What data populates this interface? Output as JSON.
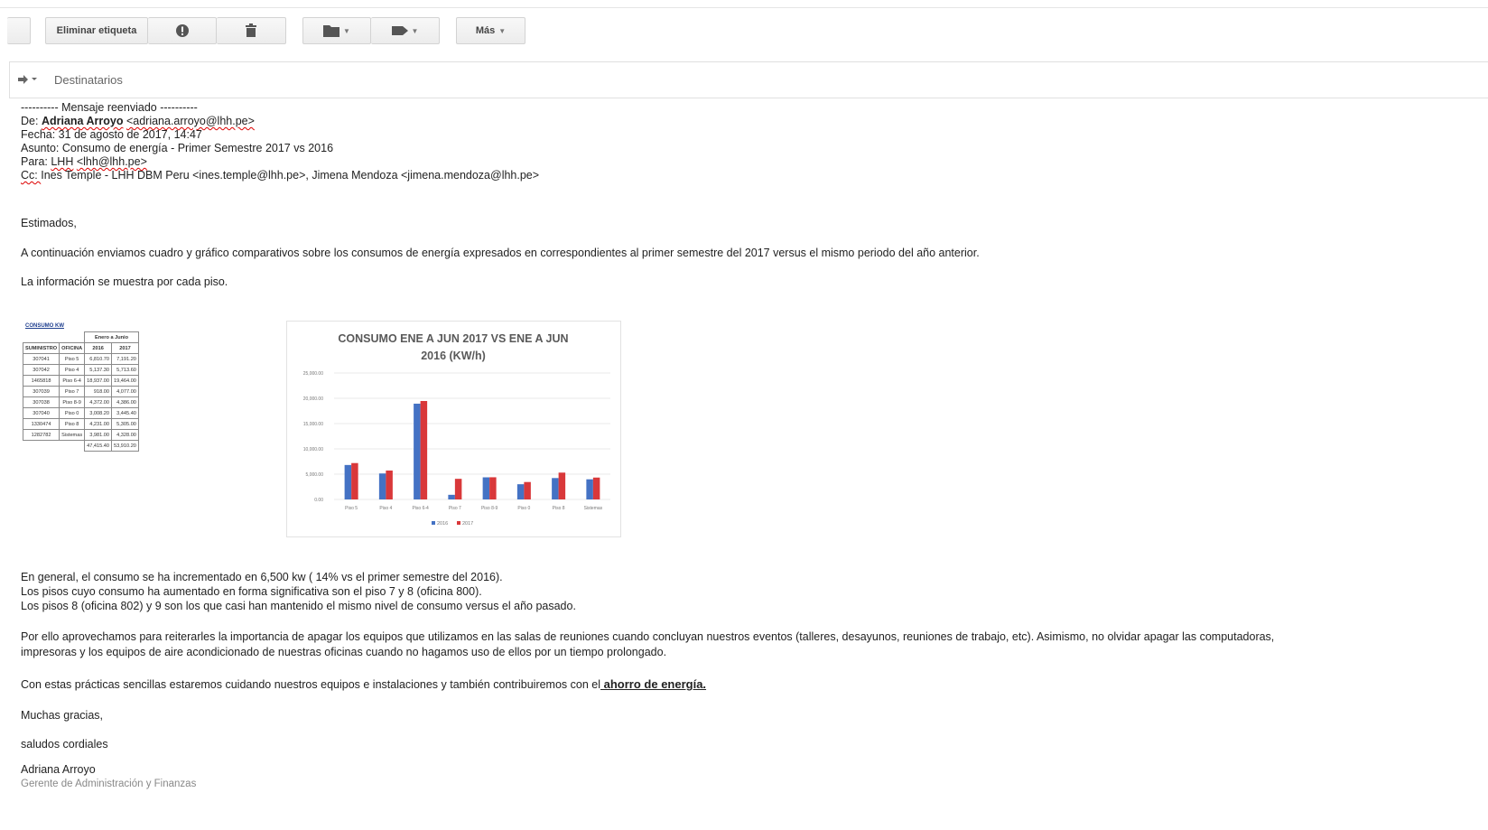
{
  "toolbar": {
    "remove_label": "Eliminar etiqueta",
    "more_label": "Más"
  },
  "recipients_label": "Destinatarios",
  "forward": {
    "header": "---------- Mensaje reenviado ----------",
    "from_label": "De: ",
    "from_name": "Adriana Arroyo",
    "from_email": "<adriana.arroyo@lhh.pe>",
    "date_line": "Fecha: 31 de agosto de 2017, 14:47",
    "subject_line": "Asunto: Consumo de energía - Primer Semestre 2017 vs 2016",
    "to_label": "Para: ",
    "to_name": "LHH",
    "to_email": "<lhh@lhh.pe>",
    "cc_label": "Cc: ",
    "cc_text": "Ines Temple - LHH DBM Peru <ines.temple@lhh.pe>, Jimena Mendoza <jimena.mendoza@lhh.pe>"
  },
  "body": {
    "greeting": "Estimados,",
    "intro": "A continuación enviamos  cuadro y gráfico comparativos sobre los consumos de energía expresados en  correspondientes al primer semestre del 2017 versus el mismo periodo del año anterior.",
    "info": "La información se muestra por cada piso.",
    "summary_1": "En general, el consumo se ha incrementado en 6,500 kw ( 14% vs el primer semestre del 2016).",
    "summary_2": "Los pisos cuyo consumo ha aumentado en forma significativa son el piso 7 y 8 (oficina 800).",
    "summary_3": "Los pisos 8 (oficina 802) y 9 son los que casi han mantenido el mismo nivel de consumo versus el año pasado.",
    "advice_1": "Por ello aprovechamos para reiterarles la importancia de apagar los equipos  que utilizamos en las salas de reuniones cuando concluyan nuestros eventos (talleres, desayunos, reuniones de trabajo, etc).  Asimismo, no olvidar apagar las computadoras,",
    "advice_2": "impresoras y los equipos de aire acondicionado de nuestras oficinas cuando no hagamos uso de ellos por un tiempo prolongado.",
    "closing_pre": "Con estas prácticas sencillas estaremos cuidando nuestros equipos e instalaciones y también contribuiremos  con el",
    "closing_bold": " ahorro de energía.",
    "thanks": "Muchas gracias,",
    "regards": "saludos cordiales",
    "sig_name": "Adriana Arroyo",
    "sig_role": "Gerente de Administración y Finanzas"
  },
  "kw_table": {
    "title": "CONSUMO KW",
    "period": "Enero a Junio",
    "headers": [
      "SUMINISTRO",
      "OFICINA",
      "2016",
      "2017"
    ],
    "rows": [
      [
        "307041",
        "Piso 5",
        "6,810.70",
        "7,191.20"
      ],
      [
        "307042",
        "Piso 4",
        "5,137.30",
        "5,713.60"
      ],
      [
        "1465818",
        "Piso 6-4",
        "18,937.00",
        "19,464.00"
      ],
      [
        "307039",
        "Piso 7",
        "918.00",
        "4,077.00"
      ],
      [
        "307038",
        "Piso 8-9",
        "4,372.00",
        "4,386.00"
      ],
      [
        "307040",
        "Piso 0",
        "3,008.20",
        "3,445.40"
      ],
      [
        "1330474",
        "Piso 8",
        "4,231.00",
        "5,305.00"
      ],
      [
        "1282782",
        "Sistemas",
        "3,981.00",
        "4,328.00"
      ]
    ],
    "totals": [
      "47,415.40",
      "53,910.20"
    ]
  },
  "chart_data": {
    "type": "bar",
    "title_line1": "CONSUMO ENE A JUN 2017 VS ENE A JUN",
    "title_line2": "2016 (KW/h)",
    "categories": [
      "Piso 5",
      "Piso 4",
      "Piso 6-4",
      "Piso 7",
      "Piso 8-9",
      "Piso 0",
      "Piso 8",
      "Sistemas"
    ],
    "series": [
      {
        "name": "2016",
        "color": "#4472c4",
        "values": [
          6810.7,
          5137.3,
          18937,
          918,
          4372,
          3008.2,
          4231,
          3981
        ]
      },
      {
        "name": "2017",
        "color": "#d9383a",
        "values": [
          7191.2,
          5713.6,
          19464,
          4077,
          4386,
          3445.4,
          5305,
          4328
        ]
      }
    ],
    "ylim": [
      0,
      25000
    ],
    "yticks": [
      "0.00",
      "5,000.00",
      "10,000.00",
      "15,000.00",
      "20,000.00",
      "25,000.00"
    ],
    "legend": "bottom"
  }
}
